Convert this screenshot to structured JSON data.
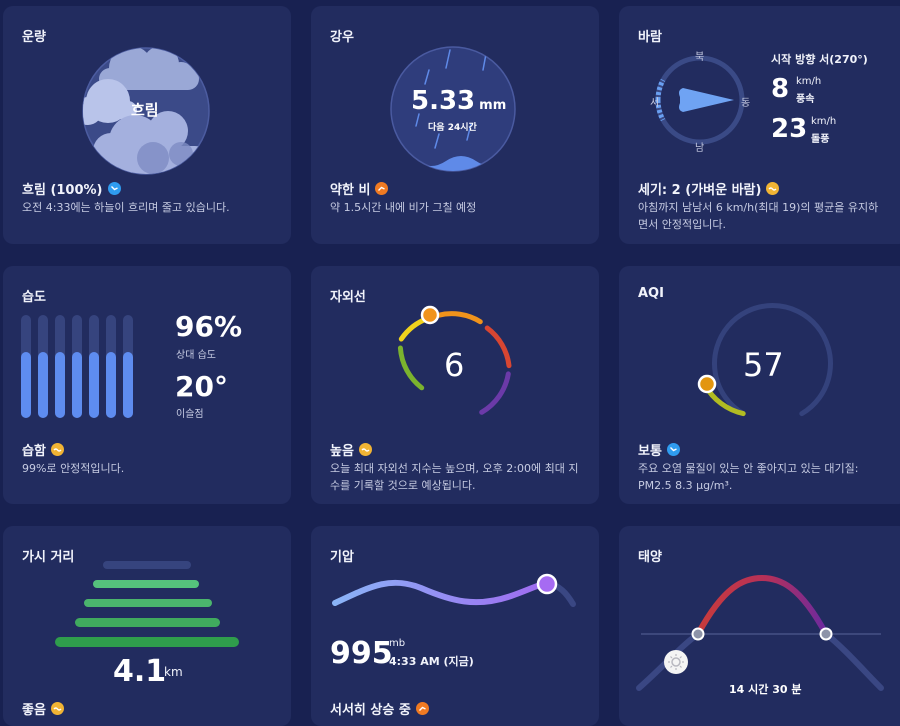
{
  "cloud": {
    "title": "운량",
    "center_label": "흐림",
    "status": "흐림 (100%)",
    "status_icon": "trend-down-icon",
    "status_color": "#2f9cf0",
    "desc": "오전 4:33에는 하늘이 흐리며 줄고 있습니다."
  },
  "rain": {
    "title": "강우",
    "amount": "5.33",
    "unit": "mm",
    "period": "다음 24시간",
    "status": "약한 비",
    "status_icon": "trend-up-icon",
    "status_color": "#f07a22",
    "desc": "약 1.5시간 내에 비가 그칠 예정"
  },
  "wind": {
    "title": "바람",
    "compass": {
      "north": "북",
      "south": "남",
      "east": "동",
      "west": "서"
    },
    "start_direction": "시작 방향 서(270°)",
    "speed_value": "8",
    "speed_unit": "km/h",
    "speed_label": "풍속",
    "gust_value": "23",
    "gust_unit": "km/h",
    "gust_label": "돌풍",
    "status": "세기: 2 (가벼운 바람)",
    "status_icon": "trend-flat-icon",
    "status_color": "#f1b434",
    "desc": "아침까지 남남서 6 km/h(최대 19)의 평균을 유지하면서 안정적입니다."
  },
  "humidity": {
    "title": "습도",
    "value": "96%",
    "value_label": "상대 습도",
    "dew_point": "20°",
    "dew_label": "이슬점",
    "level": 0.68,
    "status": "습함",
    "status_icon": "trend-flat-icon",
    "status_color": "#f1b434",
    "desc": "99%로 안정적입니다."
  },
  "uv": {
    "title": "자외선",
    "value": "6",
    "level_fraction": 0.55,
    "status": "높음",
    "status_icon": "trend-flat-icon",
    "status_color": "#f1b434",
    "desc": "오늘 최대 자외선 지수는 높으며, 오후 2:00에 최대 지수를 기록할 것으로 예상됩니다."
  },
  "aqi": {
    "title": "AQI",
    "value": "57",
    "level_fraction": 0.19,
    "status": "보통",
    "status_icon": "trend-down-icon",
    "status_color": "#2f9cf0",
    "desc": "주요 오염 물질이 있는 안 좋아지고 있는 대기질: PM2.5 8.3 µg/m³."
  },
  "visibility": {
    "title": "가시 거리",
    "value": "4.1",
    "unit": "km",
    "bars_lit": 4,
    "bars_total": 5,
    "status": "좋음",
    "status_icon": "trend-flat-icon",
    "status_color": "#f1b434"
  },
  "pressure": {
    "title": "기압",
    "value": "995",
    "unit": "mb",
    "time": "4:33 AM (지금)",
    "status": "서서히 상승 중",
    "status_icon": "trend-up-icon",
    "status_color": "#f07a22"
  },
  "sun": {
    "title": "태양",
    "daylight": "14 시간 30 분"
  }
}
